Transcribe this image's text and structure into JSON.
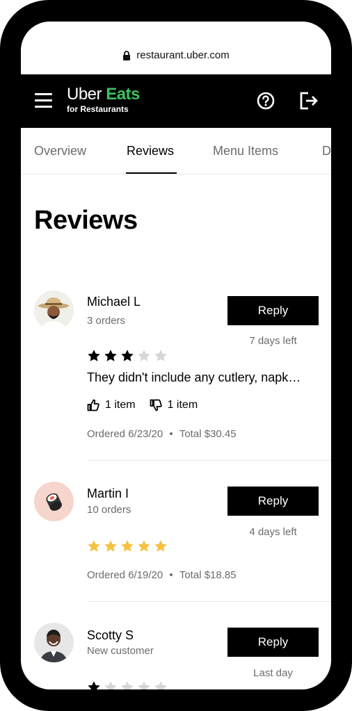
{
  "browser": {
    "url": "restaurant.uber.com"
  },
  "header": {
    "logo_uber": "Uber",
    "logo_eats": "Eats",
    "logo_sub": "for Restaurants"
  },
  "tabs": [
    {
      "label": "Overview"
    },
    {
      "label": "Reviews"
    },
    {
      "label": "Menu Items"
    },
    {
      "label": "D"
    }
  ],
  "page": {
    "title": "Reviews"
  },
  "reviews": [
    {
      "name": "Michael L",
      "orders": "3 orders",
      "reply_label": "Reply",
      "days_left": "7 days left",
      "rating": 3,
      "text": "They didn't include any cutlery, napk…",
      "likes": "1 item",
      "dislikes": "1 item",
      "ordered": "Ordered 6/23/20",
      "total": "Total $30.45",
      "star_color": "#000000"
    },
    {
      "name": "Martin I",
      "orders": "10 orders",
      "reply_label": "Reply",
      "days_left": "4 days left",
      "rating": 5,
      "ordered": "Ordered 6/19/20",
      "total": "Total $18.85",
      "star_color": "#f5c242"
    },
    {
      "name": "Scotty S",
      "orders": "New customer",
      "reply_label": "Reply",
      "days_left": "Last day",
      "rating": 1,
      "star_color": "#000000"
    }
  ],
  "colors": {
    "brand_green": "#3fc060",
    "empty_star": "#d6d6d6",
    "muted_text": "#6b6b6b"
  }
}
